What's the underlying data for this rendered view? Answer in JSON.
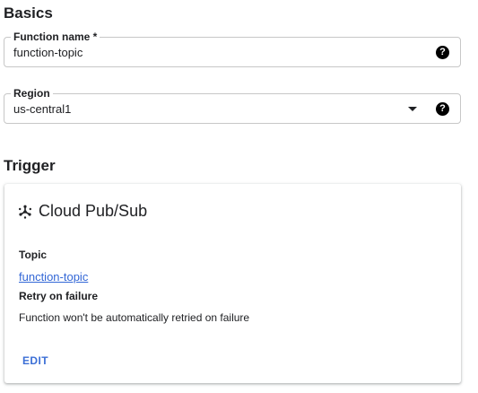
{
  "basics": {
    "title": "Basics",
    "function_name": {
      "label": "Function name *",
      "value": "function-topic"
    },
    "region": {
      "label": "Region",
      "value": "us-central1"
    },
    "help_glyph": "?"
  },
  "trigger": {
    "title": "Trigger",
    "card": {
      "icon": "pubsub-icon",
      "title": "Cloud Pub/Sub",
      "topic_label": "Topic",
      "topic_value": "function-topic",
      "retry_label": "Retry on failure",
      "retry_description": "Function won't be automatically retried on failure",
      "edit_label": "EDIT"
    }
  },
  "colors": {
    "link": "#3367d6",
    "edit": "#3c6fd6",
    "text": "#202124",
    "border": "#c7c7c7"
  }
}
